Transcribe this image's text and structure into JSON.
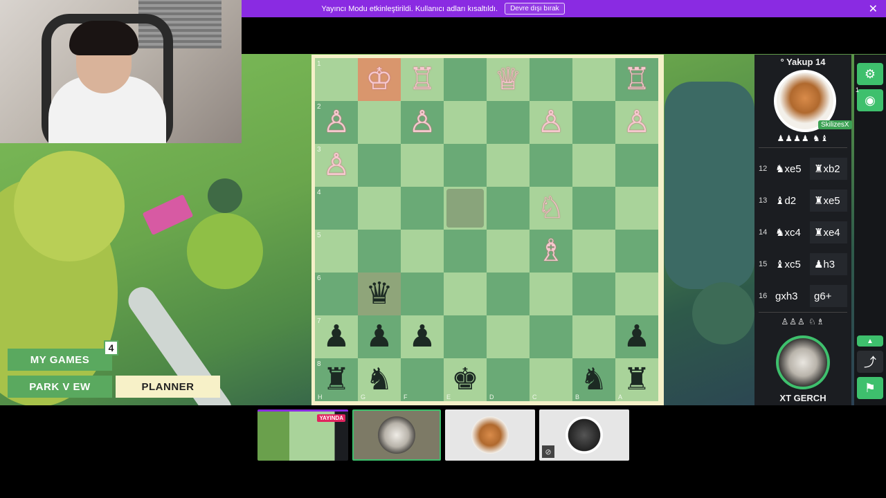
{
  "banner": {
    "message": "Yayıncı Modu etkinleştirildi. Kullanıcı adları kısaltıldı.",
    "disable_label": "Devre dışı bırak",
    "close_glyph": "✕"
  },
  "nav": {
    "my_games": "MY GAMES",
    "my_games_count": "4",
    "park_view": "PARK V EW",
    "planner": "PLANNER"
  },
  "board": {
    "ranks": [
      "1",
      "2",
      "3",
      "4",
      "5",
      "6",
      "7",
      "8"
    ],
    "files": [
      "H",
      "G",
      "F",
      "E",
      "D",
      "C",
      "B",
      "A"
    ],
    "rows": [
      [
        "",
        "♔",
        "♖",
        "",
        "♕",
        "",
        "",
        "♖"
      ],
      [
        "♙",
        "",
        "♙",
        "",
        "",
        "♙",
        "",
        "♙"
      ],
      [
        "♙",
        "",
        "",
        "",
        "",
        "",
        "",
        ""
      ],
      [
        "",
        "",
        "",
        "",
        "",
        "♘",
        "",
        ""
      ],
      [
        "",
        "",
        "",
        "",
        "",
        "♗",
        "",
        ""
      ],
      [
        "",
        "♛",
        "",
        "",
        "",
        "",
        "",
        ""
      ],
      [
        "♟",
        "♟",
        "♟",
        "",
        "",
        "",
        "",
        "♟"
      ],
      [
        "♜",
        "♞",
        "",
        "♚",
        "",
        "",
        "♞",
        "♜"
      ]
    ],
    "colors": [
      [
        "",
        "w",
        "w",
        "",
        "w",
        "",
        "",
        "w"
      ],
      [
        "w",
        "",
        "w",
        "",
        "",
        "w",
        "",
        "w"
      ],
      [
        "w",
        "",
        "",
        "",
        "",
        "",
        "",
        ""
      ],
      [
        "",
        "",
        "",
        "",
        "",
        "w",
        "",
        ""
      ],
      [
        "",
        "",
        "",
        "",
        "",
        "w",
        "",
        ""
      ],
      [
        "",
        "b",
        "",
        "",
        "",
        "",
        "",
        ""
      ],
      [
        "b",
        "b",
        "b",
        "",
        "",
        "",
        "",
        "b"
      ],
      [
        "b",
        "b",
        "",
        "b",
        "",
        "",
        "b",
        "b"
      ]
    ]
  },
  "opponent": {
    "name": "° Yakup 14",
    "tag": "SkilizesX",
    "captured": "♟♟♟♟ ♞♝"
  },
  "player": {
    "name": "XT GERCH",
    "captured": "♙♙♙ ♘♗"
  },
  "moves": [
    {
      "num": "12",
      "white": "♞xe5",
      "black": "♜xb2"
    },
    {
      "num": "13",
      "white": "♝d2",
      "black": "♜xe5"
    },
    {
      "num": "14",
      "white": "♞xc4",
      "black": "♜xe4"
    },
    {
      "num": "15",
      "white": "♝xc5",
      "black": "♟h3"
    },
    {
      "num": "16",
      "white": "gxh3",
      "black": "g6+"
    }
  ],
  "toolbar": {
    "settings_icon": "⚙",
    "eye_icon": "◉",
    "eye_count": "1",
    "up_icon": "▲",
    "share_icon": "⤴",
    "flag_icon": "⚑"
  },
  "thumbs": {
    "live_label": "YAYINDA"
  }
}
